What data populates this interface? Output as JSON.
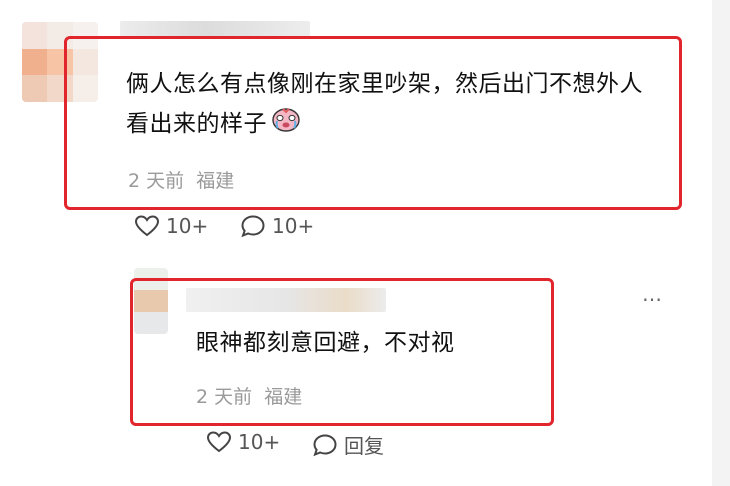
{
  "comment1": {
    "text": "俩人怎么有点像刚在家里吵架，然后出门不想外人看出来的样子",
    "emoji_icon": "crying-face-icon",
    "time": "2 天前",
    "location": "福建",
    "likes": "10+",
    "replies": "10+"
  },
  "reply1": {
    "text": "眼神都刻意回避，不对视",
    "time": "2 天前",
    "location": "福建",
    "likes": "10+",
    "reply_label": "回复",
    "more_label": "…"
  },
  "colors": {
    "highlight": "#e0262c",
    "meta": "#9a9a9a"
  }
}
